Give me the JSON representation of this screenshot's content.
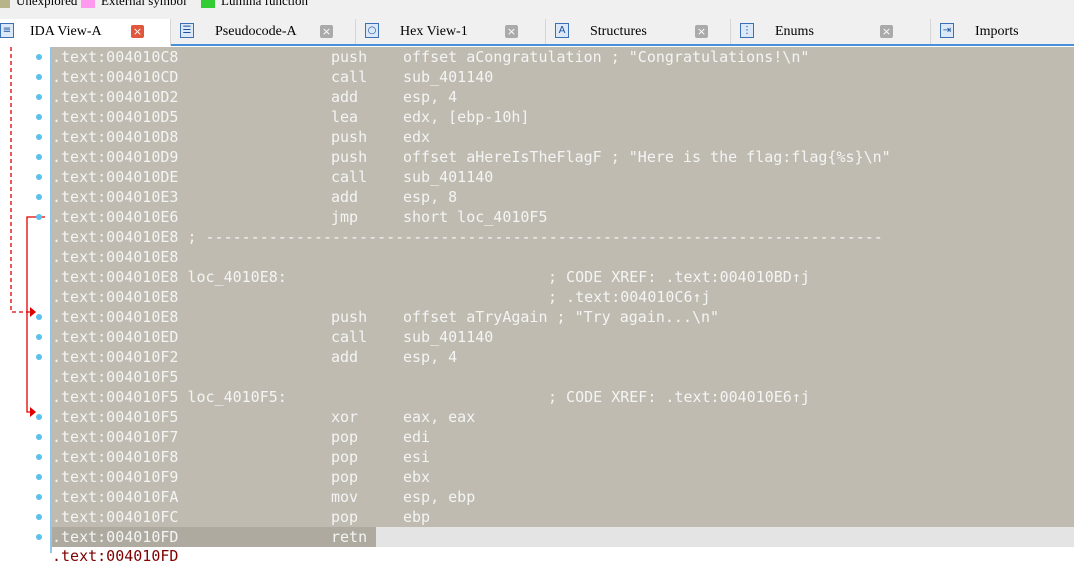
{
  "legend": [
    {
      "label": "Unexplored",
      "color": "#b8b48a"
    },
    {
      "label": "External symbol",
      "color": "#ff99ee"
    },
    {
      "label": "Lumina function",
      "color": "#33cc33"
    }
  ],
  "tabs": [
    {
      "label": "IDA View-A",
      "icon": "ida-view-icon",
      "active": true
    },
    {
      "label": "Pseudocode-A",
      "icon": "pseudocode-icon"
    },
    {
      "label": "Hex View-1",
      "icon": "hex-view-icon"
    },
    {
      "label": "Structures",
      "icon": "structures-icon"
    },
    {
      "label": "Enums",
      "icon": "enums-icon"
    },
    {
      "label": "Imports",
      "icon": "imports-icon"
    }
  ],
  "colors": {
    "code_bg": "#bfbbb0",
    "highlight": "#aeaa9f",
    "arrow": "#e00000",
    "dot": "#5bc0f0"
  },
  "rows": [
    {
      "addr": ".text:004010C8",
      "mn": "push",
      "op": "offset aCongratulation ; \"Congratulations!\\n\"",
      "dot": true
    },
    {
      "addr": ".text:004010CD",
      "mn": "call",
      "op": "sub_401140",
      "dot": true
    },
    {
      "addr": ".text:004010D2",
      "mn": "add",
      "op": "esp, 4",
      "dot": true
    },
    {
      "addr": ".text:004010D5",
      "mn": "lea",
      "op": "edx, [ebp-10h]",
      "dot": true
    },
    {
      "addr": ".text:004010D8",
      "mn": "push",
      "op": "edx",
      "dot": true
    },
    {
      "addr": ".text:004010D9",
      "mn": "push",
      "op": "offset aHereIsTheFlagF ; \"Here is the flag:flag{%s}\\n\"",
      "dot": true
    },
    {
      "addr": ".text:004010DE",
      "mn": "call",
      "op": "sub_401140",
      "dot": true
    },
    {
      "addr": ".text:004010E3",
      "mn": "add",
      "op": "esp, 8",
      "dot": true
    },
    {
      "addr": ".text:004010E6",
      "mn": "jmp",
      "op": "short loc_4010F5",
      "dot": true
    },
    {
      "addr": ".text:004010E8 ; ---------------------------------------------------------------------------"
    },
    {
      "addr": ".text:004010E8"
    },
    {
      "addr": ".text:004010E8 loc_4010E8:",
      "cm": "; CODE XREF: .text:004010BD↑j"
    },
    {
      "addr": ".text:004010E8",
      "cm": "; .text:004010C6↑j"
    },
    {
      "addr": ".text:004010E8",
      "mn": "push",
      "op": "offset aTryAgain ; \"Try again...\\n\"",
      "dot": true
    },
    {
      "addr": ".text:004010ED",
      "mn": "call",
      "op": "sub_401140",
      "dot": true
    },
    {
      "addr": ".text:004010F2",
      "mn": "add",
      "op": "esp, 4",
      "dot": true
    },
    {
      "addr": ".text:004010F5"
    },
    {
      "addr": ".text:004010F5 loc_4010F5:",
      "cm": "; CODE XREF: .text:004010E6↑j"
    },
    {
      "addr": ".text:004010F5",
      "mn": "xor",
      "op": "eax, eax",
      "dot": true
    },
    {
      "addr": ".text:004010F7",
      "mn": "pop",
      "op": "edi",
      "dot": true
    },
    {
      "addr": ".text:004010F8",
      "mn": "pop",
      "op": "esi",
      "dot": true
    },
    {
      "addr": ".text:004010F9",
      "mn": "pop",
      "op": "ebx",
      "dot": true
    },
    {
      "addr": ".text:004010FA",
      "mn": "mov",
      "op": "esp, ebp",
      "dot": true
    },
    {
      "addr": ".text:004010FC",
      "mn": "pop",
      "op": "ebp",
      "dot": true
    },
    {
      "addr": ".text:004010FD",
      "mn": "retn",
      "dot": true,
      "current": true
    }
  ],
  "partial_row": ".text:004010FD"
}
